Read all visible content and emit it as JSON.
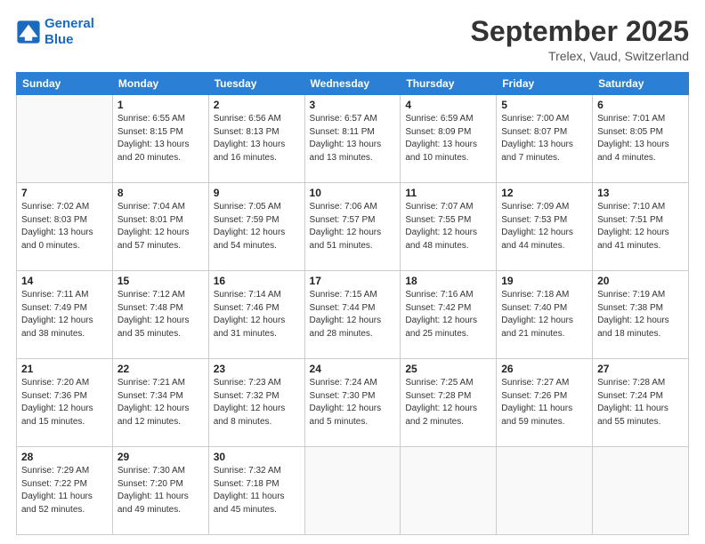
{
  "header": {
    "logo_line1": "General",
    "logo_line2": "Blue",
    "month": "September 2025",
    "location": "Trelex, Vaud, Switzerland"
  },
  "weekdays": [
    "Sunday",
    "Monday",
    "Tuesday",
    "Wednesday",
    "Thursday",
    "Friday",
    "Saturday"
  ],
  "weeks": [
    [
      {
        "day": "",
        "info": ""
      },
      {
        "day": "1",
        "info": "Sunrise: 6:55 AM\nSunset: 8:15 PM\nDaylight: 13 hours\nand 20 minutes."
      },
      {
        "day": "2",
        "info": "Sunrise: 6:56 AM\nSunset: 8:13 PM\nDaylight: 13 hours\nand 16 minutes."
      },
      {
        "day": "3",
        "info": "Sunrise: 6:57 AM\nSunset: 8:11 PM\nDaylight: 13 hours\nand 13 minutes."
      },
      {
        "day": "4",
        "info": "Sunrise: 6:59 AM\nSunset: 8:09 PM\nDaylight: 13 hours\nand 10 minutes."
      },
      {
        "day": "5",
        "info": "Sunrise: 7:00 AM\nSunset: 8:07 PM\nDaylight: 13 hours\nand 7 minutes."
      },
      {
        "day": "6",
        "info": "Sunrise: 7:01 AM\nSunset: 8:05 PM\nDaylight: 13 hours\nand 4 minutes."
      }
    ],
    [
      {
        "day": "7",
        "info": "Sunrise: 7:02 AM\nSunset: 8:03 PM\nDaylight: 13 hours\nand 0 minutes."
      },
      {
        "day": "8",
        "info": "Sunrise: 7:04 AM\nSunset: 8:01 PM\nDaylight: 12 hours\nand 57 minutes."
      },
      {
        "day": "9",
        "info": "Sunrise: 7:05 AM\nSunset: 7:59 PM\nDaylight: 12 hours\nand 54 minutes."
      },
      {
        "day": "10",
        "info": "Sunrise: 7:06 AM\nSunset: 7:57 PM\nDaylight: 12 hours\nand 51 minutes."
      },
      {
        "day": "11",
        "info": "Sunrise: 7:07 AM\nSunset: 7:55 PM\nDaylight: 12 hours\nand 48 minutes."
      },
      {
        "day": "12",
        "info": "Sunrise: 7:09 AM\nSunset: 7:53 PM\nDaylight: 12 hours\nand 44 minutes."
      },
      {
        "day": "13",
        "info": "Sunrise: 7:10 AM\nSunset: 7:51 PM\nDaylight: 12 hours\nand 41 minutes."
      }
    ],
    [
      {
        "day": "14",
        "info": "Sunrise: 7:11 AM\nSunset: 7:49 PM\nDaylight: 12 hours\nand 38 minutes."
      },
      {
        "day": "15",
        "info": "Sunrise: 7:12 AM\nSunset: 7:48 PM\nDaylight: 12 hours\nand 35 minutes."
      },
      {
        "day": "16",
        "info": "Sunrise: 7:14 AM\nSunset: 7:46 PM\nDaylight: 12 hours\nand 31 minutes."
      },
      {
        "day": "17",
        "info": "Sunrise: 7:15 AM\nSunset: 7:44 PM\nDaylight: 12 hours\nand 28 minutes."
      },
      {
        "day": "18",
        "info": "Sunrise: 7:16 AM\nSunset: 7:42 PM\nDaylight: 12 hours\nand 25 minutes."
      },
      {
        "day": "19",
        "info": "Sunrise: 7:18 AM\nSunset: 7:40 PM\nDaylight: 12 hours\nand 21 minutes."
      },
      {
        "day": "20",
        "info": "Sunrise: 7:19 AM\nSunset: 7:38 PM\nDaylight: 12 hours\nand 18 minutes."
      }
    ],
    [
      {
        "day": "21",
        "info": "Sunrise: 7:20 AM\nSunset: 7:36 PM\nDaylight: 12 hours\nand 15 minutes."
      },
      {
        "day": "22",
        "info": "Sunrise: 7:21 AM\nSunset: 7:34 PM\nDaylight: 12 hours\nand 12 minutes."
      },
      {
        "day": "23",
        "info": "Sunrise: 7:23 AM\nSunset: 7:32 PM\nDaylight: 12 hours\nand 8 minutes."
      },
      {
        "day": "24",
        "info": "Sunrise: 7:24 AM\nSunset: 7:30 PM\nDaylight: 12 hours\nand 5 minutes."
      },
      {
        "day": "25",
        "info": "Sunrise: 7:25 AM\nSunset: 7:28 PM\nDaylight: 12 hours\nand 2 minutes."
      },
      {
        "day": "26",
        "info": "Sunrise: 7:27 AM\nSunset: 7:26 PM\nDaylight: 11 hours\nand 59 minutes."
      },
      {
        "day": "27",
        "info": "Sunrise: 7:28 AM\nSunset: 7:24 PM\nDaylight: 11 hours\nand 55 minutes."
      }
    ],
    [
      {
        "day": "28",
        "info": "Sunrise: 7:29 AM\nSunset: 7:22 PM\nDaylight: 11 hours\nand 52 minutes."
      },
      {
        "day": "29",
        "info": "Sunrise: 7:30 AM\nSunset: 7:20 PM\nDaylight: 11 hours\nand 49 minutes."
      },
      {
        "day": "30",
        "info": "Sunrise: 7:32 AM\nSunset: 7:18 PM\nDaylight: 11 hours\nand 45 minutes."
      },
      {
        "day": "",
        "info": ""
      },
      {
        "day": "",
        "info": ""
      },
      {
        "day": "",
        "info": ""
      },
      {
        "day": "",
        "info": ""
      }
    ]
  ]
}
